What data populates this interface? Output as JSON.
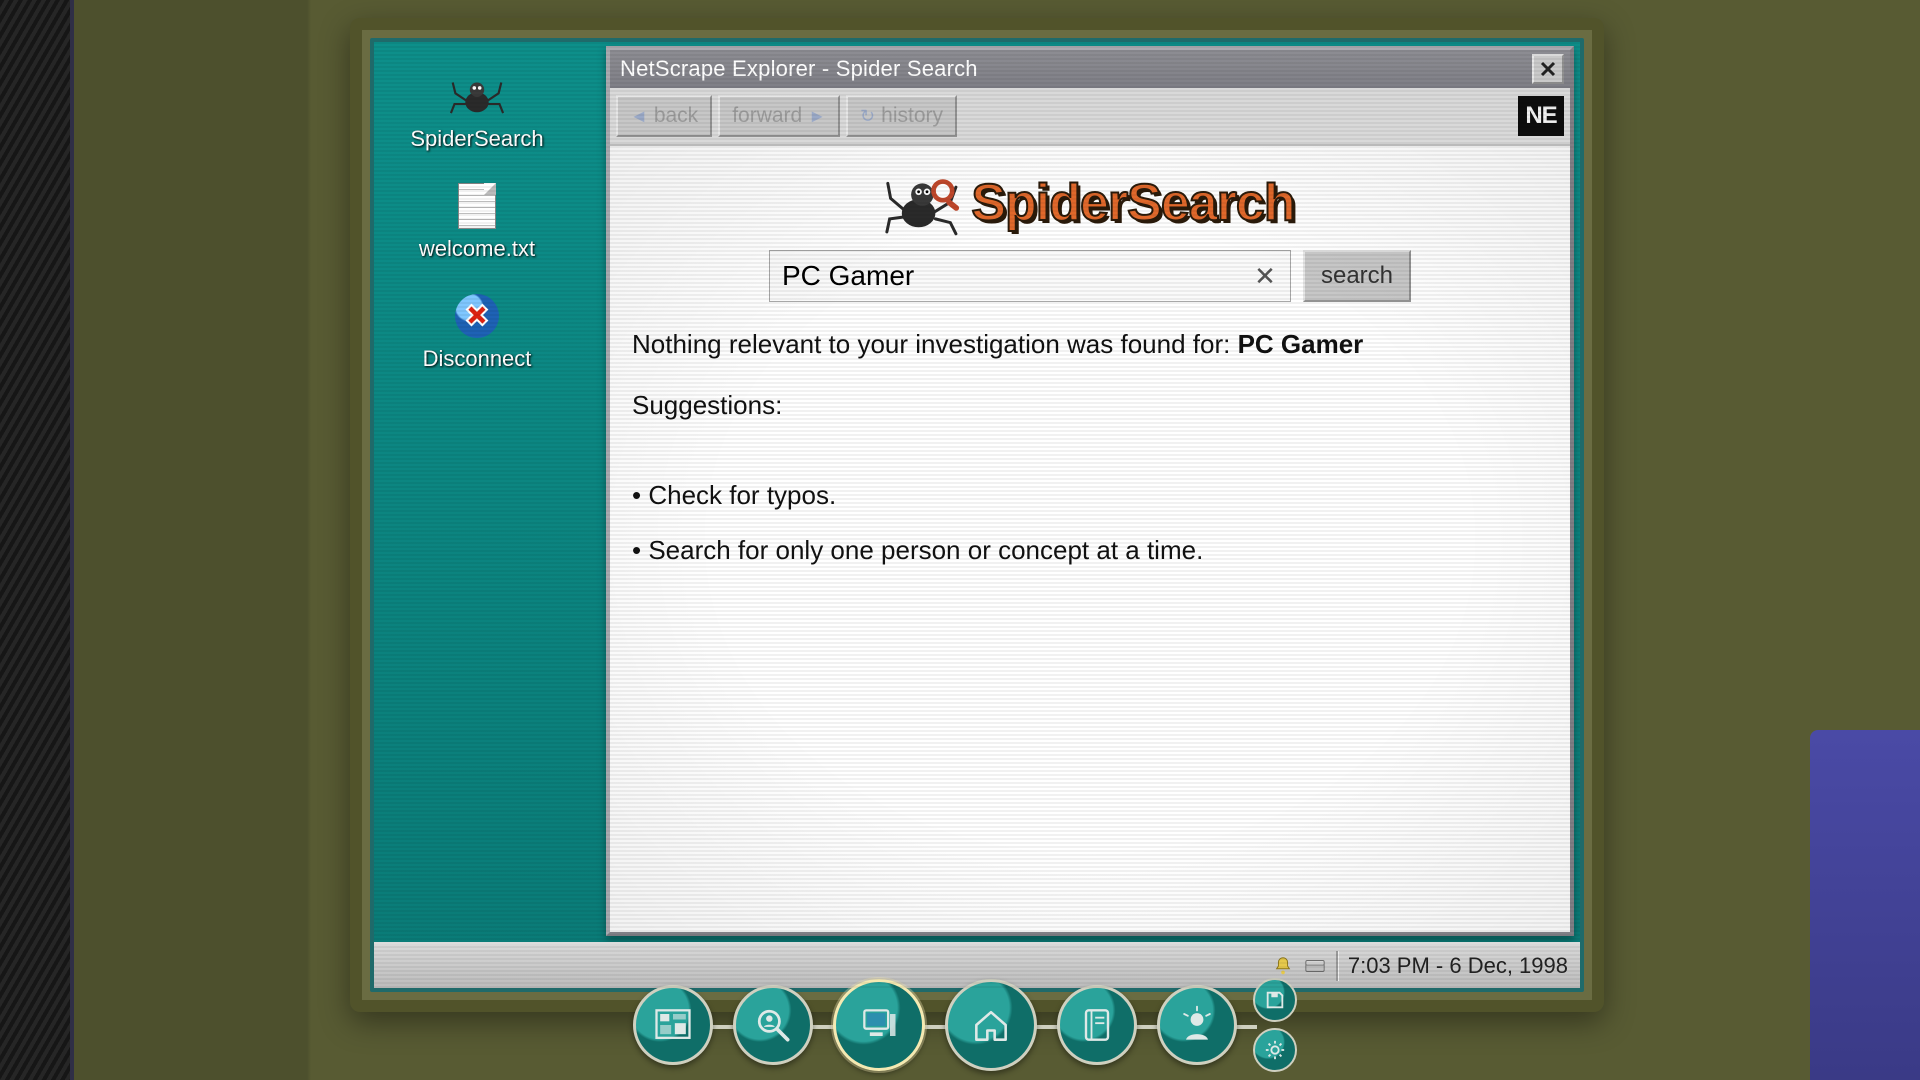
{
  "desktop": {
    "icons": [
      {
        "label": "SpiderSearch"
      },
      {
        "label": "welcome.txt"
      },
      {
        "label": "Disconnect"
      }
    ]
  },
  "window": {
    "title": "NetScrape Explorer - Spider Search",
    "toolbar": {
      "back": "back",
      "forward": "forward",
      "history": "history",
      "logo": "NE"
    }
  },
  "page": {
    "brand": "SpiderSearch",
    "search": {
      "value": "PC Gamer",
      "button": "search"
    },
    "no_results_prefix": "Nothing relevant to your investigation was found for: ",
    "no_results_query": "PC Gamer",
    "suggestions_label": "Suggestions:",
    "suggestions": [
      "Check for typos.",
      "Search for only one person or concept at a time."
    ]
  },
  "taskbar": {
    "clock": "7:03 PM - 6 Dec, 1998"
  }
}
